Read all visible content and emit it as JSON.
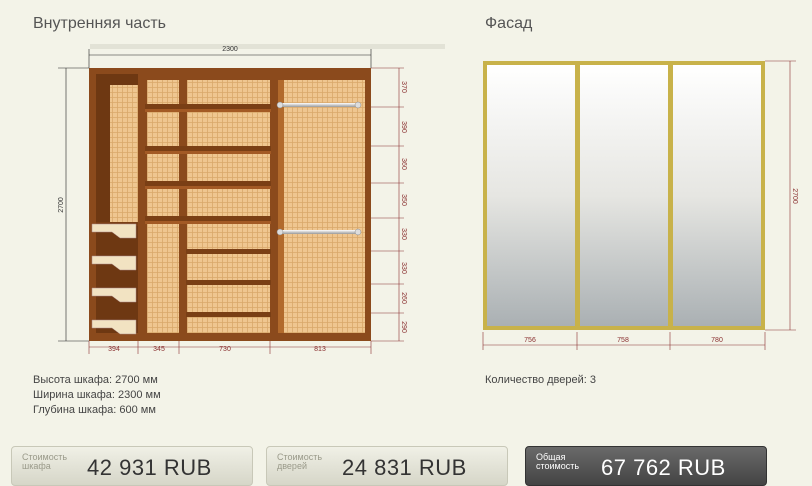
{
  "headers": {
    "inner": "Внутренняя часть",
    "facade": "Фасад"
  },
  "inner_dims": {
    "width_top": "2300",
    "height_left": "2700",
    "shelf_heights": [
      "370",
      "390",
      "360",
      "350",
      "330",
      "330",
      "260",
      "290"
    ],
    "bottom_widths": [
      "394",
      "345",
      "730",
      "813"
    ]
  },
  "facade_dims": {
    "height_right": "2700",
    "bottom_widths": [
      "756",
      "758",
      "780"
    ]
  },
  "info": {
    "height": "Высота шкафа: 2700 мм",
    "width": "Ширина шкафа: 2300 мм",
    "depth": "Глубина шкафа: 600 мм",
    "doors": "Количество дверей: 3"
  },
  "prices": {
    "cabinet_label": "Стоимость шкафа",
    "cabinet_value": "42 931  RUB",
    "doors_label": "Стоимость дверей",
    "doors_value": "24 831  RUB",
    "total_label": "Общая стоимость",
    "total_value": "67 762  RUB"
  },
  "colors": {
    "wood": "#8b4a1c",
    "panel": "#ecc48c",
    "frame": "#c8b24a",
    "dim": "#8a3030"
  }
}
